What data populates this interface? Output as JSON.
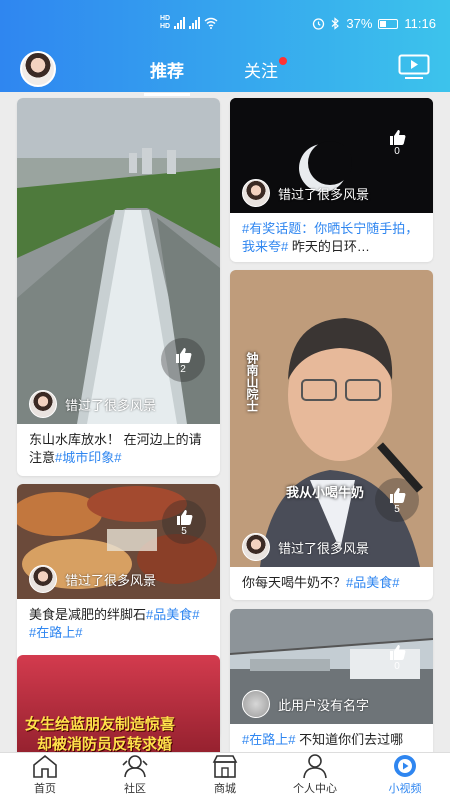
{
  "status_bar": {
    "battery": "37%",
    "time": "11:16"
  },
  "tabs": [
    {
      "label": "推荐",
      "active": true
    },
    {
      "label": "关注",
      "has_dot": true
    }
  ],
  "cards": [
    {
      "likes": "2",
      "author": "错过了很多风景",
      "caption": "东山水库放水！ 在河边上的请注意",
      "tags": "#城市印象#"
    },
    {
      "likes": "0",
      "author": "错过了很多风景",
      "tags_pre": "#有奖话题：你晒长宁随手拍，我来夸#",
      "caption": " 昨天的日环…"
    },
    {
      "likes": "5",
      "author": "错过了很多风景",
      "caption": "美食是减肥的绊脚石",
      "tags": "#品美食# #在路上#"
    },
    {
      "likes": "5",
      "author": "错过了很多风景",
      "overlay_top": "钟南山院士",
      "overlay_bottom": "我从小喝牛奶",
      "caption": "你每天喝牛奶不？",
      "tags": "#品美食#"
    },
    {
      "banner_1": "女生给蓝朋友制造惊喜",
      "banner_2": "却被消防员反转求婚"
    },
    {
      "likes": "0",
      "author": "此用户没有名字",
      "tags_pre": "#在路上#",
      "caption": " 不知道你们去过哪"
    }
  ],
  "nav": [
    {
      "label": "首页",
      "icon": "home-icon"
    },
    {
      "label": "社区",
      "icon": "community-icon"
    },
    {
      "label": "商城",
      "icon": "store-icon"
    },
    {
      "label": "个人中心",
      "icon": "person-icon"
    },
    {
      "label": "小视频",
      "icon": "video-icon",
      "active": true
    }
  ],
  "colors": {
    "primary": "#2f86f0",
    "gradient_end": "#3cc3ec",
    "dot": "#ff3333"
  }
}
